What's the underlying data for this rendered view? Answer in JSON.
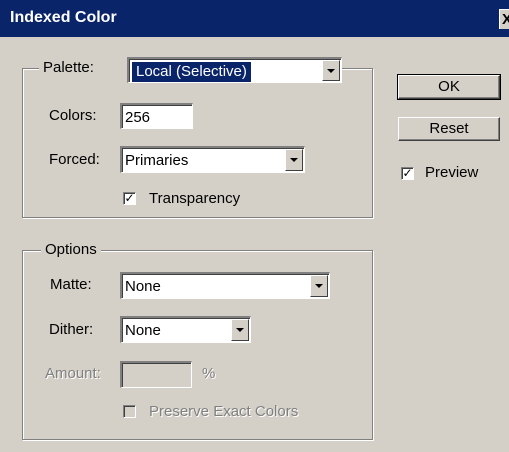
{
  "window": {
    "title": "Indexed Color",
    "close_glyph": "X"
  },
  "palette_group": {
    "palette_label": "Palette:",
    "palette_value": "Local (Selective)",
    "colors_label": "Colors:",
    "colors_value": "256",
    "forced_label": "Forced:",
    "forced_value": "Primaries",
    "transparency_label": "Transparency",
    "transparency_checked": true
  },
  "options_group": {
    "legend": "Options",
    "matte_label": "Matte:",
    "matte_value": "None",
    "dither_label": "Dither:",
    "dither_value": "None",
    "amount_label": "Amount:",
    "amount_value": "",
    "amount_unit": "%",
    "preserve_label": "Preserve Exact Colors",
    "preserve_checked": false
  },
  "buttons": {
    "ok": "OK",
    "reset": "Reset"
  },
  "preview": {
    "label": "Preview",
    "checked": true
  },
  "check_glyph": "✓",
  "colors": {
    "titlebar": "#0a246a",
    "face": "#d4d0c8",
    "selection": "#0a246a"
  }
}
